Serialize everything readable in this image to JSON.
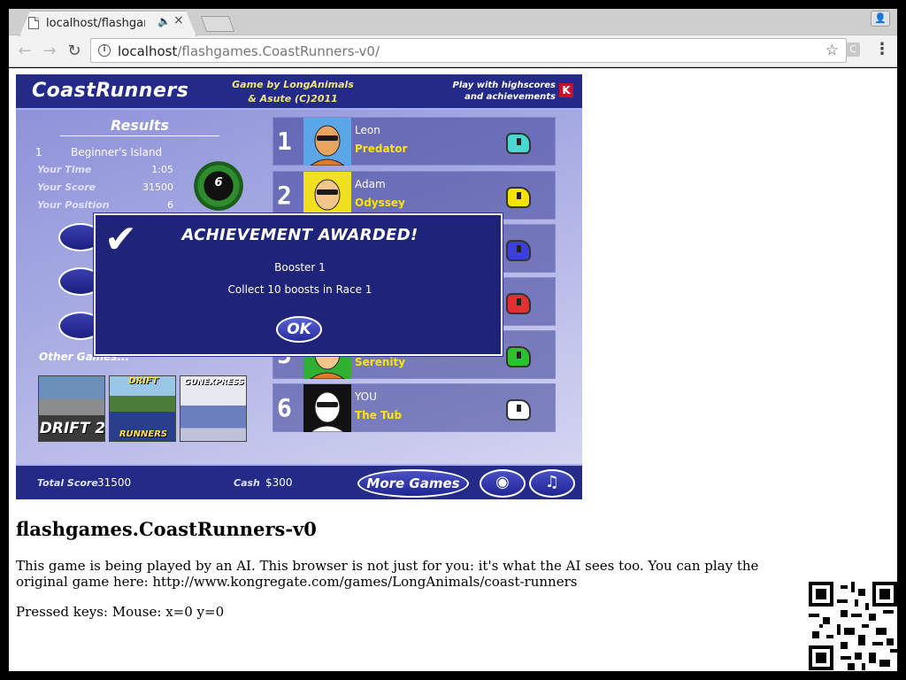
{
  "browser": {
    "tab_title": "localhost/flashgam",
    "url_host": "localhost",
    "url_path": "/flashgames.CoastRunners-v0/",
    "ext_label": "C"
  },
  "game": {
    "logo": "CoastRunners",
    "credit_line1": "Game by LongAnimals",
    "credit_line2": "& Asute (C)2011",
    "play_line1": "Play with highscores",
    "play_line2": "and achievements",
    "k_logo": "K",
    "results_title": "Results",
    "race_number": "1",
    "race_name": "Beginner's Island",
    "stats": [
      {
        "label": "Your Time",
        "value": "1:05"
      },
      {
        "label": "Your Score",
        "value": "31500"
      },
      {
        "label": "Your Position",
        "value": "6"
      }
    ],
    "position_badge": "6",
    "other_games_label": "Other Games...",
    "thumbs": {
      "drift2": "DRIFT 2",
      "drift_runners_top": "DRIFT",
      "drift_runners_bot": "RUNNERS",
      "gunexpress": "GUNEXPRESS"
    },
    "rankings": [
      {
        "rank": "1",
        "name": "Leon",
        "boat": "Predator",
        "boat_color": "#48d8d0",
        "face": "#e8a560",
        "bg": "#5aa6e6"
      },
      {
        "rank": "2",
        "name": "Adam",
        "boat": "Odyssey",
        "boat_color": "#f5e400",
        "face": "#f2c58a",
        "bg": "#f0e020"
      },
      {
        "rank": "3",
        "name": "",
        "boat": "",
        "boat_color": "#3a40d8",
        "face": "#f2c58a",
        "bg": "#5aa6e6"
      },
      {
        "rank": "4",
        "name": "",
        "boat": "",
        "boat_color": "#e03030",
        "face": "#f2c58a",
        "bg": "#e04040"
      },
      {
        "rank": "5",
        "name": "",
        "boat": "Serenity",
        "boat_color": "#2ec02e",
        "face": "#f2c58a",
        "bg": "#30b030"
      },
      {
        "rank": "6",
        "name": "YOU",
        "boat": "The Tub",
        "boat_color": "#ffffff",
        "face": "#ffffff",
        "bg": "#111111"
      }
    ],
    "footer": {
      "total_score_label": "Total Score",
      "total_score": "31500",
      "cash_label": "Cash",
      "cash": "$300",
      "more_games": "More Games"
    },
    "achievement": {
      "title": "ACHIEVEMENT AWARDED!",
      "name": "Booster 1",
      "description": "Collect 10 boosts in Race 1",
      "ok": "OK"
    }
  },
  "page": {
    "heading": "flashgames.CoastRunners-v0",
    "description": "This game is being played by an AI. This browser is not just for you: it's what the AI sees too. You can play the original game here: http://www.kongregate.com/games/LongAnimals/coast-runners",
    "pressed_keys": "Pressed keys: Mouse: x=0 y=0"
  }
}
